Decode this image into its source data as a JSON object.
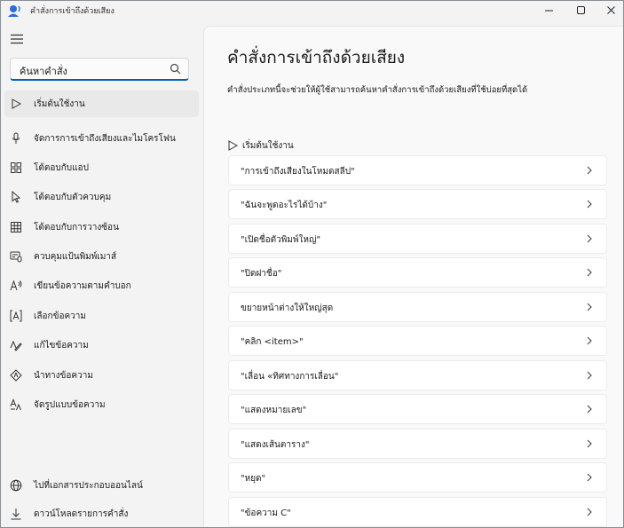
{
  "window": {
    "title": "คำสั่งการเข้าถึงด้วยเสียง"
  },
  "sidebar": {
    "search_text": "ค้นหาคำสั่ง",
    "items": [
      {
        "label": "เริ่มต้นใช้งาน",
        "icon": "play-icon",
        "selected": true
      },
      {
        "label": "จัดการการเข้าถึงเสียงและไมโครโฟน",
        "icon": "microphone-icon"
      },
      {
        "label": "โต้ตอบกับแอป",
        "icon": "apps-icon"
      },
      {
        "label": "โต้ตอบกับตัวควบคุม",
        "icon": "cursor-icon"
      },
      {
        "label": "โต้ตอบกับการวางซ้อน",
        "icon": "grid-icon"
      },
      {
        "label": "ควบคุมแป้นพิมพ์เมาส์",
        "icon": "keyboard-mouse-icon"
      },
      {
        "label": "เขียนข้อความตามคำบอก",
        "icon": "dictation-icon"
      },
      {
        "label": "เลือกข้อความ",
        "icon": "text-select-icon"
      },
      {
        "label": "แก้ไขข้อความ",
        "icon": "edit-text-icon"
      },
      {
        "label": "นำทางข้อความ",
        "icon": "navigate-text-icon"
      },
      {
        "label": "จัดรูปแบบข้อความ",
        "icon": "format-text-icon"
      }
    ],
    "bottom_items": [
      {
        "label": "ไปที่เอกสารประกอบออนไลน์",
        "icon": "globe-icon"
      },
      {
        "label": "ดาวน์โหลดรายการคำสั่ง",
        "icon": "download-icon"
      }
    ]
  },
  "main": {
    "title": "คำสั่งการเข้าถึงด้วยเสียง",
    "description": "คำสั่งประเภทนี้จะช่วยให้ผู้ใช้สามารถค้นหาคำสั่งการเข้าถึงด้วยเสียงที่ใช้บ่อยที่สุดได้",
    "section_title": "เริ่มต้นใช้งาน",
    "commands": [
      "\"การเข้าถึงเสียงในโหมดสลีป\"",
      "\"ฉันจะพูดอะไรได้บ้าง\"",
      "\"เปิดชื่อตัวพิมพ์ใหญ่\"",
      "\"ปิดฝาชื่อ\"",
      "ขยายหน้าต่างให้ใหญ่สุด",
      "\"คลิก <item>\"",
      "\"เลื่อน «ทิศทางการเลื่อน\"",
      "\"แสดงหมายเลข\"",
      "\"แสดงเส้นตาราง\"",
      "\"หยุด\"",
      "\"ข้อความ C\""
    ]
  },
  "colors": {
    "accent": "#005fb8",
    "selected_bg": "#e9e9e9",
    "app_icon": "#2b6fd6"
  }
}
